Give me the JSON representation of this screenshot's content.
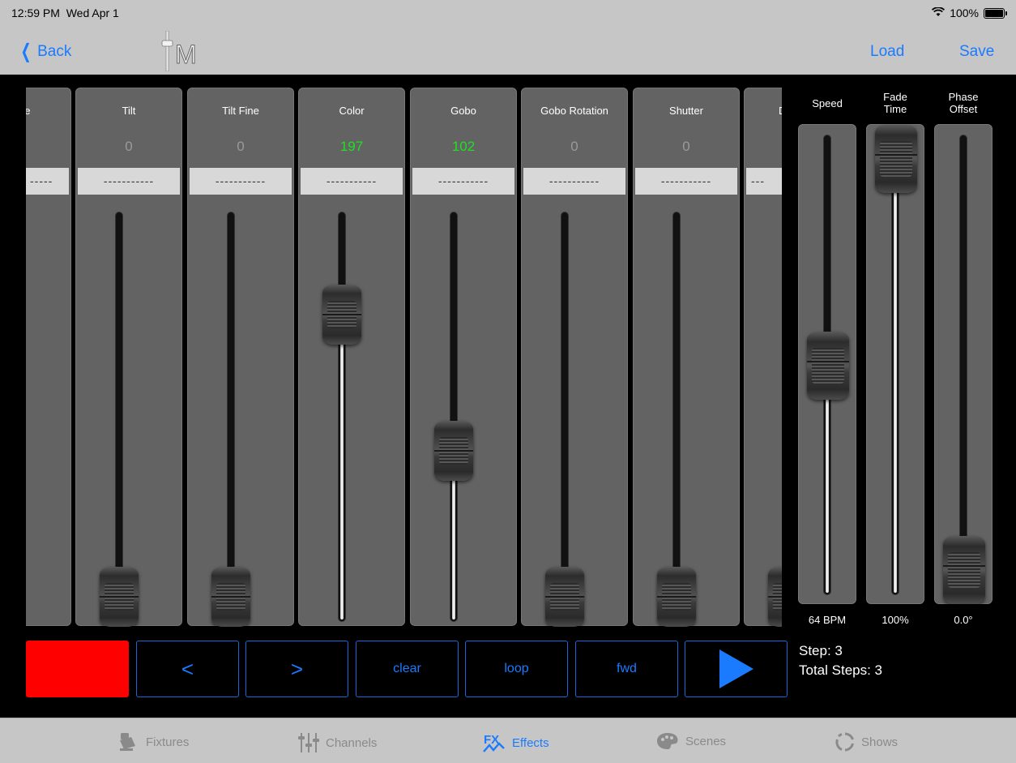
{
  "status_bar": {
    "time": "12:59 PM",
    "date": "Wed Apr 1",
    "battery": "100%"
  },
  "nav": {
    "back_label": "Back",
    "load_label": "Load",
    "save_label": "Save",
    "logo_text": "M"
  },
  "channels": [
    {
      "name": "ne",
      "value": "",
      "label": "-----",
      "active": false,
      "level": 0
    },
    {
      "name": "Tilt",
      "value": "0",
      "label": "-----------",
      "active": false,
      "level": 0
    },
    {
      "name": "Tilt Fine",
      "value": "0",
      "label": "-----------",
      "active": false,
      "level": 0
    },
    {
      "name": "Color",
      "value": "197",
      "label": "-----------",
      "active": true,
      "level": 0.773
    },
    {
      "name": "Gobo",
      "value": "102",
      "label": "-----------",
      "active": true,
      "level": 0.4
    },
    {
      "name": "Gobo Rotation",
      "value": "0",
      "label": "-----------",
      "active": false,
      "level": 0
    },
    {
      "name": "Shutter",
      "value": "0",
      "label": "-----------",
      "active": false,
      "level": 0
    },
    {
      "name": "D",
      "value": "",
      "label": "---",
      "active": false,
      "level": 0
    }
  ],
  "right_panel": [
    {
      "title_line1": "Speed",
      "title_line2": "",
      "value": "64 BPM",
      "level": 0.5
    },
    {
      "title_line1": "Fade",
      "title_line2": "Time",
      "value": "100%",
      "level": 1.0
    },
    {
      "title_line1": "Phase",
      "title_line2": "Offset",
      "value": "0.0°",
      "level": 0.0
    }
  ],
  "controls": {
    "prev_label": "<",
    "next_label": ">",
    "clear_label": "clear",
    "loop_label": "loop",
    "direction_label": "fwd"
  },
  "step_info": {
    "step": "Step: 3",
    "total": "Total Steps: 3"
  },
  "tabs": [
    {
      "label": "Fixtures",
      "icon": "fixtures-icon",
      "active": false
    },
    {
      "label": "Channels",
      "icon": "channels-icon",
      "active": false
    },
    {
      "label": "Effects",
      "icon": "effects-icon",
      "active": true
    },
    {
      "label": "Scenes",
      "icon": "scenes-icon",
      "active": false
    },
    {
      "label": "Shows",
      "icon": "shows-icon",
      "active": false
    }
  ],
  "colors": {
    "accent": "#1a7bff",
    "active_value": "#20e020",
    "record": "#ff0000"
  }
}
